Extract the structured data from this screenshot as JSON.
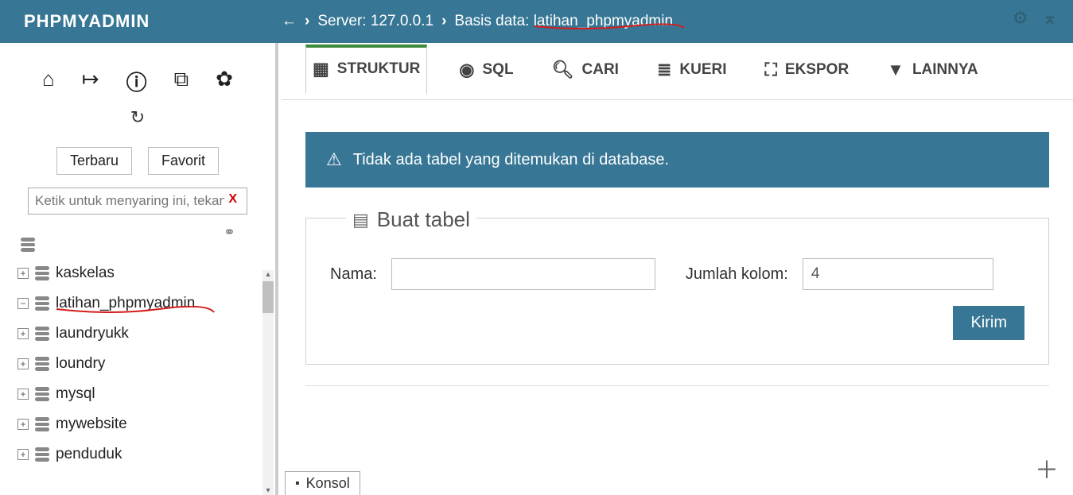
{
  "logo": "PHPMYADMIN",
  "breadcrumb": {
    "server_label": "Server: 127.0.0.1",
    "db_label": "Basis data: ",
    "db_name": "latihan_phpmyadmin"
  },
  "sidebar_tabs": {
    "recent": "Terbaru",
    "favorite": "Favorit"
  },
  "filter_placeholder": "Ketik untuk menyaring ini, tekan Enter untuk menyaring",
  "tree": [
    {
      "name": "kaskelas",
      "expanded": false
    },
    {
      "name": "latihan_phpmyadmin",
      "expanded": true,
      "active": true
    },
    {
      "name": "laundryukk",
      "expanded": false
    },
    {
      "name": "loundry",
      "expanded": false
    },
    {
      "name": "mysql",
      "expanded": false
    },
    {
      "name": "mywebsite",
      "expanded": false
    },
    {
      "name": "penduduk",
      "expanded": false
    }
  ],
  "tabs": {
    "struktur": "STRUKTUR",
    "sql": "SQL",
    "cari": "CARI",
    "kueri": "KUERI",
    "ekspor": "EKSPOR",
    "lainnya": "LAINNYA"
  },
  "alert_text": "Tidak ada tabel yang ditemukan di database.",
  "create": {
    "legend": "Buat tabel",
    "name_label": "Nama:",
    "cols_label": "Jumlah kolom:",
    "cols_value": "4",
    "submit": "Kirim"
  },
  "console_label": "Konsol"
}
